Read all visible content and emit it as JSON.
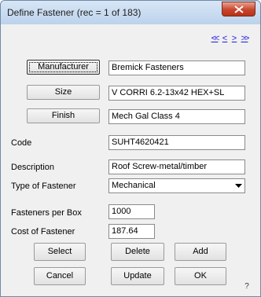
{
  "window": {
    "title": "Define Fastener (rec = 1 of 183)"
  },
  "nav": {
    "first": "<<",
    "prev": "<",
    "next": ">",
    "last": ">>"
  },
  "form": {
    "manufacturer_button": "Manufacturer",
    "manufacturer_value": "Bremick Fasteners",
    "size_button": "Size",
    "size_value": "V CORRI 6.2-13x42 HEX+SL",
    "finish_button": "Finish",
    "finish_value": "Mech Gal Class 4",
    "code_label": "Code",
    "code_value": "SUHT4620421",
    "description_label": "Description",
    "description_value": "Roof Screw-metal/timber",
    "type_label": "Type of Fastener",
    "type_value": "Mechanical",
    "per_box_label": "Fasteners per Box",
    "per_box_value": "1000",
    "cost_label": "Cost of Fastener",
    "cost_value": "187.64"
  },
  "buttons": {
    "select": "Select",
    "delete": "Delete",
    "add": "Add",
    "cancel": "Cancel",
    "update": "Update",
    "ok": "OK"
  },
  "help": "?"
}
